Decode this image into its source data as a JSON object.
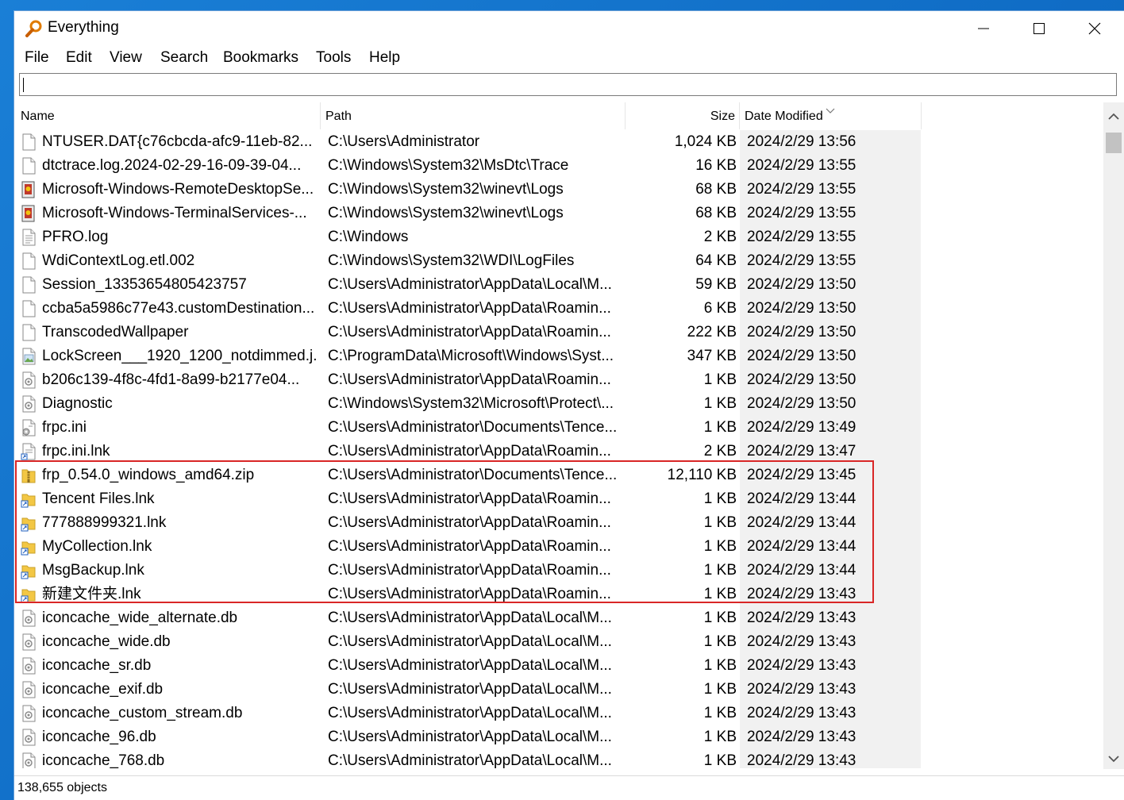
{
  "window": {
    "title": "Everything",
    "icon": "magnifier-icon"
  },
  "menu": [
    "File",
    "Edit",
    "View",
    "Search",
    "Bookmarks",
    "Tools",
    "Help"
  ],
  "search": {
    "value": ""
  },
  "columns": {
    "name": "Name",
    "path": "Path",
    "size": "Size",
    "date": "Date Modified"
  },
  "rows": [
    {
      "icon": "file-icon",
      "name": "NTUSER.DAT{c76cbcda-afc9-11eb-82...",
      "path": "C:\\Users\\Administrator",
      "size": "1,024 KB",
      "date": "2024/2/29 13:56"
    },
    {
      "icon": "file-icon",
      "name": "dtctrace.log.2024-02-29-16-09-39-04...",
      "path": "C:\\Windows\\System32\\MsDtc\\Trace",
      "size": "16 KB",
      "date": "2024/2/29 13:55"
    },
    {
      "icon": "event-log-icon",
      "name": "Microsoft-Windows-RemoteDesktopSe...",
      "path": "C:\\Windows\\System32\\winevt\\Logs",
      "size": "68 KB",
      "date": "2024/2/29 13:55"
    },
    {
      "icon": "event-log-icon",
      "name": "Microsoft-Windows-TerminalServices-...",
      "path": "C:\\Windows\\System32\\winevt\\Logs",
      "size": "68 KB",
      "date": "2024/2/29 13:55"
    },
    {
      "icon": "text-file-icon",
      "name": "PFRO.log",
      "path": "C:\\Windows",
      "size": "2 KB",
      "date": "2024/2/29 13:55"
    },
    {
      "icon": "file-icon",
      "name": "WdiContextLog.etl.002",
      "path": "C:\\Windows\\System32\\WDI\\LogFiles",
      "size": "64 KB",
      "date": "2024/2/29 13:55"
    },
    {
      "icon": "file-icon",
      "name": "Session_13353654805423757",
      "path": "C:\\Users\\Administrator\\AppData\\Local\\M...",
      "size": "59 KB",
      "date": "2024/2/29 13:50"
    },
    {
      "icon": "file-icon",
      "name": "ccba5a5986c77e43.customDestination...",
      "path": "C:\\Users\\Administrator\\AppData\\Roamin...",
      "size": "6 KB",
      "date": "2024/2/29 13:50"
    },
    {
      "icon": "file-icon",
      "name": "TranscodedWallpaper",
      "path": "C:\\Users\\Administrator\\AppData\\Roamin...",
      "size": "222 KB",
      "date": "2024/2/29 13:50"
    },
    {
      "icon": "image-file-icon",
      "name": "LockScreen___1920_1200_notdimmed.j...",
      "path": "C:\\ProgramData\\Microsoft\\Windows\\Syst...",
      "size": "347 KB",
      "date": "2024/2/29 13:50"
    },
    {
      "icon": "system-file-icon",
      "name": "b206c139-4f8c-4fd1-8a99-b2177e04...",
      "path": "C:\\Users\\Administrator\\AppData\\Roamin...",
      "size": "1 KB",
      "date": "2024/2/29 13:50"
    },
    {
      "icon": "system-file-icon",
      "name": "Diagnostic",
      "path": "C:\\Windows\\System32\\Microsoft\\Protect\\...",
      "size": "1 KB",
      "date": "2024/2/29 13:50"
    },
    {
      "icon": "config-file-icon",
      "name": "frpc.ini",
      "path": "C:\\Users\\Administrator\\Documents\\Tence...",
      "size": "1 KB",
      "date": "2024/2/29 13:49"
    },
    {
      "icon": "shortcut-file-icon",
      "name": "frpc.ini.lnk",
      "path": "C:\\Users\\Administrator\\AppData\\Roamin...",
      "size": "2 KB",
      "date": "2024/2/29 13:47"
    },
    {
      "icon": "zip-folder-icon",
      "name": "frp_0.54.0_windows_amd64.zip",
      "path": "C:\\Users\\Administrator\\Documents\\Tence...",
      "size": "12,110 KB",
      "date": "2024/2/29 13:45"
    },
    {
      "icon": "folder-shortcut-icon",
      "name": "Tencent Files.lnk",
      "path": "C:\\Users\\Administrator\\AppData\\Roamin...",
      "size": "1 KB",
      "date": "2024/2/29 13:44"
    },
    {
      "icon": "folder-shortcut-icon",
      "name": "777888999321.lnk",
      "path": "C:\\Users\\Administrator\\AppData\\Roamin...",
      "size": "1 KB",
      "date": "2024/2/29 13:44"
    },
    {
      "icon": "folder-shortcut-icon",
      "name": "MyCollection.lnk",
      "path": "C:\\Users\\Administrator\\AppData\\Roamin...",
      "size": "1 KB",
      "date": "2024/2/29 13:44"
    },
    {
      "icon": "folder-shortcut-icon",
      "name": "MsgBackup.lnk",
      "path": "C:\\Users\\Administrator\\AppData\\Roamin...",
      "size": "1 KB",
      "date": "2024/2/29 13:44"
    },
    {
      "icon": "folder-shortcut-icon",
      "name": "新建文件夹.lnk",
      "path": "C:\\Users\\Administrator\\AppData\\Roamin...",
      "size": "1 KB",
      "date": "2024/2/29 13:43"
    },
    {
      "icon": "system-file-icon",
      "name": "iconcache_wide_alternate.db",
      "path": "C:\\Users\\Administrator\\AppData\\Local\\M...",
      "size": "1 KB",
      "date": "2024/2/29 13:43"
    },
    {
      "icon": "system-file-icon",
      "name": "iconcache_wide.db",
      "path": "C:\\Users\\Administrator\\AppData\\Local\\M...",
      "size": "1 KB",
      "date": "2024/2/29 13:43"
    },
    {
      "icon": "system-file-icon",
      "name": "iconcache_sr.db",
      "path": "C:\\Users\\Administrator\\AppData\\Local\\M...",
      "size": "1 KB",
      "date": "2024/2/29 13:43"
    },
    {
      "icon": "system-file-icon",
      "name": "iconcache_exif.db",
      "path": "C:\\Users\\Administrator\\AppData\\Local\\M...",
      "size": "1 KB",
      "date": "2024/2/29 13:43"
    },
    {
      "icon": "system-file-icon",
      "name": "iconcache_custom_stream.db",
      "path": "C:\\Users\\Administrator\\AppData\\Local\\M...",
      "size": "1 KB",
      "date": "2024/2/29 13:43"
    },
    {
      "icon": "system-file-icon",
      "name": "iconcache_96.db",
      "path": "C:\\Users\\Administrator\\AppData\\Local\\M...",
      "size": "1 KB",
      "date": "2024/2/29 13:43"
    },
    {
      "icon": "system-file-icon",
      "name": "iconcache_768.db",
      "path": "C:\\Users\\Administrator\\AppData\\Local\\M...",
      "size": "1 KB",
      "date": "2024/2/29 13:43"
    }
  ],
  "status": {
    "text": "138,655 objects"
  },
  "colors": {
    "highlight_border": "#d92626",
    "date_column_bg": "#f1f1f1"
  }
}
